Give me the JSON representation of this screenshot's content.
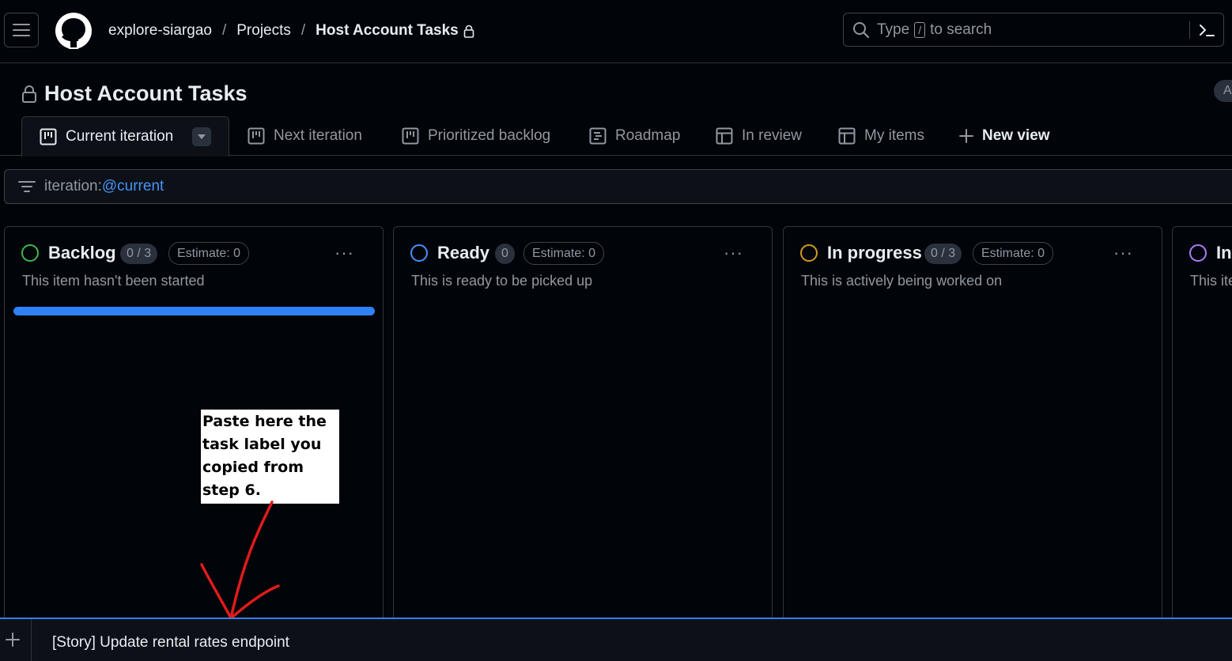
{
  "header": {
    "breadcrumbs": {
      "org": "explore-siargao",
      "section": "Projects",
      "current": "Host Account Tasks"
    },
    "search": {
      "prefix": "Type",
      "key": "/",
      "suffix": "to search"
    }
  },
  "project": {
    "title": "Host Account Tasks",
    "avatar_initial": "A"
  },
  "tabs": [
    {
      "label": "Current iteration",
      "icon": "board-icon",
      "active": true
    },
    {
      "label": "Next iteration",
      "icon": "board-icon"
    },
    {
      "label": "Prioritized backlog",
      "icon": "board-icon"
    },
    {
      "label": "Roadmap",
      "icon": "roadmap-icon"
    },
    {
      "label": "In review",
      "icon": "table-icon"
    },
    {
      "label": "My items",
      "icon": "table-icon"
    },
    {
      "label": "New view",
      "icon": "plus-icon"
    }
  ],
  "filter": {
    "key": "iteration:",
    "value": "@current"
  },
  "columns": [
    {
      "name": "Backlog",
      "count": "0 / 3",
      "estimate": "Estimate: 0",
      "description": "This item hasn't been started",
      "status_color": "#3fb950",
      "progress": 1.0
    },
    {
      "name": "Ready",
      "count": "0",
      "estimate": "Estimate: 0",
      "description": "This is ready to be picked up",
      "status_color": "#4493f8"
    },
    {
      "name": "In progress",
      "count": "0 / 3",
      "estimate": "Estimate: 0",
      "description": "This is actively being worked on",
      "status_color": "#d29922"
    },
    {
      "name": "In",
      "description": "This ite",
      "status_color": "#ab7df8"
    }
  ],
  "annotation": {
    "text": "Paste here the task label you copied from step 6."
  },
  "add_item": {
    "text": "[Story] Update rental rates endpoint"
  },
  "colors": {
    "accent": "#2f81f7",
    "background": "#010409",
    "annotation_arrow": "#e01b1b"
  }
}
